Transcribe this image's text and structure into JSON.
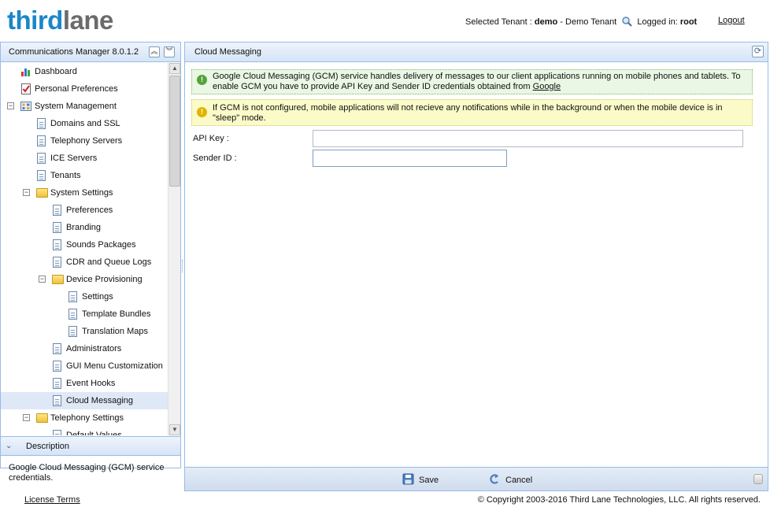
{
  "header": {
    "logo_part1": "third",
    "logo_part2": "lane",
    "selected_tenant_label": "Selected Tenant :",
    "tenant_name": "demo",
    "tenant_sep": "-",
    "tenant_desc": "Demo Tenant",
    "logged_in_label": "Logged in:",
    "user": "root",
    "logout": "Logout"
  },
  "left_panel": {
    "title": "Communications Manager 8.0.1.2",
    "tree": [
      {
        "label": "Dashboard",
        "icon": "chart-icon",
        "level": 0,
        "expander": ""
      },
      {
        "label": "Personal Preferences",
        "icon": "checklist-icon",
        "level": 0,
        "expander": ""
      },
      {
        "label": "System Management",
        "icon": "grid-icon",
        "level": 0,
        "expander": "−"
      },
      {
        "label": "Domains and SSL",
        "icon": "document-icon",
        "level": 1,
        "expander": ""
      },
      {
        "label": "Telephony Servers",
        "icon": "document-icon",
        "level": 1,
        "expander": ""
      },
      {
        "label": "ICE Servers",
        "icon": "document-icon",
        "level": 1,
        "expander": ""
      },
      {
        "label": "Tenants",
        "icon": "document-icon",
        "level": 1,
        "expander": ""
      },
      {
        "label": "System Settings",
        "icon": "folder-icon",
        "level": 1,
        "expander": "−"
      },
      {
        "label": "Preferences",
        "icon": "document-icon",
        "level": 2,
        "expander": ""
      },
      {
        "label": "Branding",
        "icon": "document-icon",
        "level": 2,
        "expander": ""
      },
      {
        "label": "Sounds Packages",
        "icon": "document-icon",
        "level": 2,
        "expander": ""
      },
      {
        "label": "CDR and Queue Logs",
        "icon": "document-icon",
        "level": 2,
        "expander": ""
      },
      {
        "label": "Device Provisioning",
        "icon": "folder-icon",
        "level": 2,
        "expander": "−"
      },
      {
        "label": "Settings",
        "icon": "document-icon",
        "level": 3,
        "expander": ""
      },
      {
        "label": "Template Bundles",
        "icon": "document-icon",
        "level": 3,
        "expander": ""
      },
      {
        "label": "Translation Maps",
        "icon": "document-icon",
        "level": 3,
        "expander": ""
      },
      {
        "label": "Administrators",
        "icon": "document-icon",
        "level": 2,
        "expander": ""
      },
      {
        "label": "GUI Menu Customization",
        "icon": "document-icon",
        "level": 2,
        "expander": ""
      },
      {
        "label": "Event Hooks",
        "icon": "document-icon",
        "level": 2,
        "expander": ""
      },
      {
        "label": "Cloud Messaging",
        "icon": "document-icon",
        "level": 2,
        "expander": "",
        "selected": true
      },
      {
        "label": "Telephony Settings",
        "icon": "folder-icon",
        "level": 1,
        "expander": "−"
      },
      {
        "label": "Default Values",
        "icon": "document-icon",
        "level": 2,
        "expander": ""
      }
    ],
    "description_title": "Description",
    "description_text": "Google Cloud Messaging (GCM) service credentials."
  },
  "main": {
    "title": "Cloud Messaging",
    "info_text": "Google Cloud Messaging (GCM) service handles delivery of messages to our client applications running on mobile phones and tablets. To enable GCM you have to provide API Key and Sender ID credentials obtained from",
    "info_link": "Google",
    "warning_text": "If GCM is not configured, mobile applications will not recieve any notifications while in the background or when the mobile device is in \"sleep\" mode.",
    "api_key_label": "API Key :",
    "api_key_value": "",
    "sender_id_label": "Sender ID :",
    "sender_id_value": "",
    "save_label": "Save",
    "cancel_label": "Cancel"
  },
  "footer": {
    "license": "License Terms",
    "copyright": "© Copyright 2003-2016 Third Lane Technologies, LLC. All rights reserved."
  },
  "colors": {
    "accent": "#1a86c8",
    "panel_border": "#99bbe8",
    "selected_row": "#dfe8f6"
  }
}
